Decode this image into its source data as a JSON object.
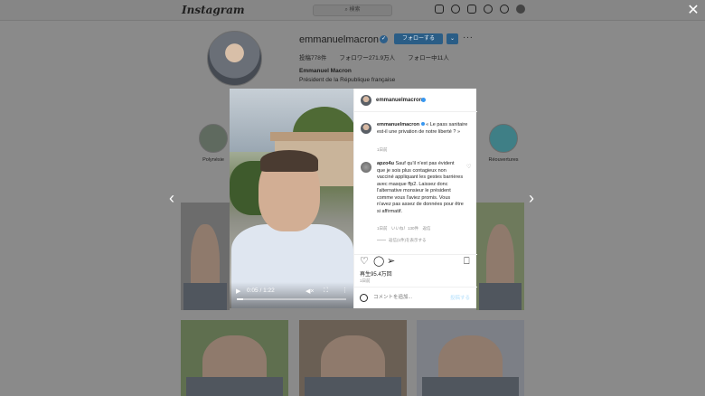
{
  "app": {
    "logo": "Instagram"
  },
  "search": {
    "placeholder": "検索"
  },
  "profile": {
    "username": "emmanuelmacron",
    "follow_label": "フォローする",
    "chevron": "⌄",
    "more": "···",
    "posts": "投稿778件",
    "followers": "フォロワー271.9万人",
    "following": "フォロー中11人",
    "display_name": "Emmanuel Macron",
    "bio": "Président de la République française"
  },
  "highlights": [
    {
      "label": "Polynésie"
    },
    {
      "label": "Réouvertures"
    }
  ],
  "modal": {
    "header_username": "emmanuelmacron",
    "caption_username": "emmanuelmacron",
    "caption_text": "« Le pass sanitaire est-il une privation de notre liberté ? »",
    "caption_age": "1日前",
    "comment_username": "apzo4u",
    "comment_text": "Sauf qu'il n'est pas évident que je sois plus contagieux non vacciné appliquant les gestes barrières avec masque ffp2. Laissez donc l'alternative monsieur le président comme vous l'aviez promis. Vous n'avez pas assez de données pour être si affirmatif.",
    "comment_meta": "1日前　いいね！130件　返信",
    "replies": "返信(1件)を表示する",
    "views": "再生95.4万回",
    "date": "1日前",
    "comment_placeholder": "コメントを追加...",
    "post_label": "投稿する"
  },
  "video": {
    "time": "0:05 / 1:22",
    "progress": 0.06
  },
  "colors": {
    "accent": "#3897f0",
    "follow_button": "#2a5d86",
    "overlay": "#7d7d7d"
  }
}
